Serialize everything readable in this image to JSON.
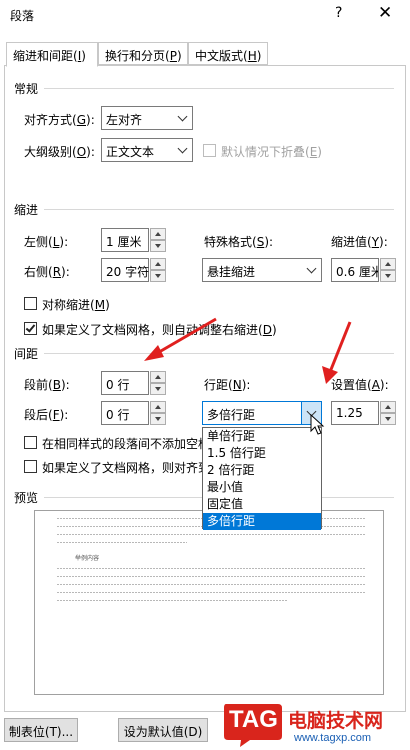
{
  "window": {
    "title": "段落",
    "help": "?",
    "close": "✕"
  },
  "tabs": [
    {
      "label": "缩进和间距",
      "key": "I"
    },
    {
      "label": "换行和分页",
      "key": "P"
    },
    {
      "label": "中文版式",
      "key": "H"
    }
  ],
  "general": {
    "section": "常规",
    "alignment_label": "对齐方式",
    "alignment_key": "G",
    "alignment_value": "左对齐",
    "outline_label": "大纲级别",
    "outline_key": "O",
    "outline_value": "正文文本",
    "collapse_label": "默认情况下折叠",
    "collapse_key": "E"
  },
  "indent": {
    "section": "缩进",
    "left_label": "左侧",
    "left_key": "L",
    "left_value": "1 厘米",
    "right_label": "右侧",
    "right_key": "R",
    "right_value": "20 字符",
    "special_label": "特殊格式",
    "special_key": "S",
    "special_value": "悬挂缩进",
    "by_label": "缩进值",
    "by_key": "Y",
    "by_value": "0.6 厘米",
    "mirror_label": "对称缩进",
    "mirror_key": "M",
    "auto_label": "如果定义了文档网格，则自动调整右缩进",
    "auto_key": "D"
  },
  "spacing": {
    "section": "间距",
    "before_label": "段前",
    "before_key": "B",
    "before_value": "0 行",
    "after_label": "段后",
    "after_key": "F",
    "after_value": "0 行",
    "line_label": "行距",
    "line_key": "N",
    "line_value": "多倍行距",
    "at_label": "设置值",
    "at_key": "A",
    "at_value": "1.25",
    "no_space_label": "在相同样式的段落间不添加空格",
    "snap_label": "如果定义了文档网格，则对齐到",
    "line_options": [
      "单倍行距",
      "1.5 倍行距",
      "2 倍行距",
      "最小值",
      "固定值",
      "多倍行距"
    ],
    "selected_index": 5
  },
  "preview": {
    "section": "预览",
    "sample_text": "举例内容"
  },
  "buttons": {
    "tabs_button": "制表位(T)...",
    "default_button": "设为默认值(D)"
  },
  "watermark": {
    "logo": "TAG",
    "site_name": "电脑技术网",
    "url": "www.tagxp.com"
  },
  "colors": {
    "accent": "#0078d7",
    "arrow": "#e0201f",
    "watermark_red": "#d9251c"
  }
}
